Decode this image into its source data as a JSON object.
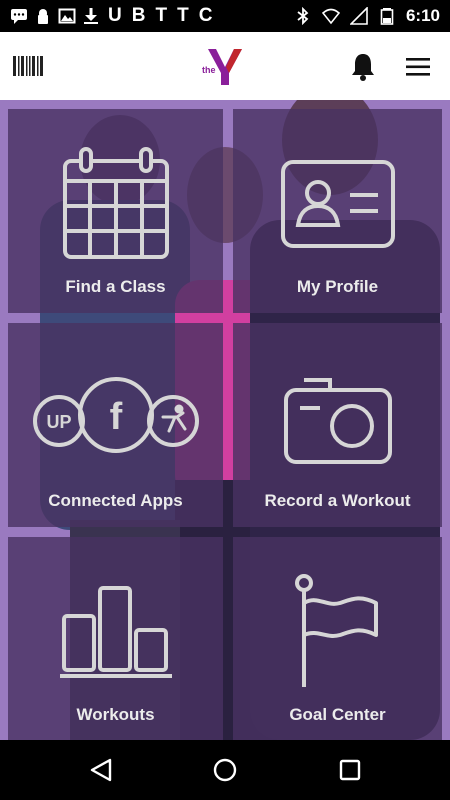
{
  "status_bar": {
    "time": "6:10",
    "letters": [
      "U",
      "B",
      "T",
      "T",
      "C"
    ],
    "left_icons": [
      "message-icon",
      "lock-icon",
      "image-icon",
      "download-icon"
    ],
    "right_icons": [
      "bluetooth-icon",
      "wifi-icon",
      "signal-icon",
      "battery-icon"
    ]
  },
  "header": {
    "logo_text": "the",
    "brand_color": "#8a1f9a",
    "icons": [
      "barcode-icon",
      "bell-icon",
      "menu-icon"
    ]
  },
  "tiles": [
    {
      "label": "Find a Class",
      "icon": "calendar-icon"
    },
    {
      "label": "My Profile",
      "icon": "id-card-icon"
    },
    {
      "label": "Connected Apps",
      "icon": "connected-apps-icon"
    },
    {
      "label": "Record a Workout",
      "icon": "camera-icon"
    },
    {
      "label": "Workouts",
      "icon": "bar-chart-icon"
    },
    {
      "label": "Goal Center",
      "icon": "flag-icon"
    }
  ],
  "connected_apps": {
    "left_badge": "UP",
    "center_badge": "f"
  },
  "nav_bar": {
    "icons": [
      "back-icon",
      "home-icon",
      "recent-apps-icon"
    ]
  },
  "colors": {
    "tile_overlay": "#483262",
    "tile_gap": "#9a7ac0",
    "icon_stroke": "#d6d6d6"
  }
}
